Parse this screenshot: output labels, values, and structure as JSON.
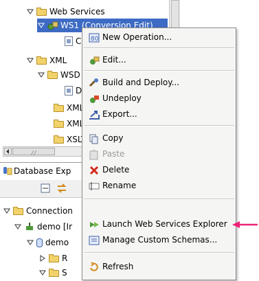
{
  "tree_top": {
    "items": [
      {
        "label": "Web Services"
      },
      {
        "label": "WS1 (Conversion Edit)"
      },
      {
        "label": "C"
      },
      {
        "label": "XML"
      },
      {
        "label": "WSD"
      },
      {
        "label": "D"
      },
      {
        "label": "XML"
      },
      {
        "label": "XML"
      },
      {
        "label": "XSLT"
      }
    ]
  },
  "db_panel": {
    "title": "Database Exp",
    "items": [
      {
        "label": "Connection"
      },
      {
        "label": "demo [Ir"
      },
      {
        "label": "demo"
      },
      {
        "label": "R"
      },
      {
        "label": "S"
      }
    ]
  },
  "context_menu": {
    "items": [
      {
        "label": "New Operation...",
        "icon": "new-operation-icon"
      },
      {
        "label": "Edit...",
        "icon": "edit-icon"
      },
      {
        "label": "Build and Deploy...",
        "icon": "build-deploy-icon"
      },
      {
        "label": "Undeploy",
        "icon": "undeploy-icon"
      },
      {
        "label": "Export...",
        "icon": "export-icon"
      },
      {
        "label": "Copy",
        "icon": "copy-icon"
      },
      {
        "label": "Paste",
        "icon": "paste-icon"
      },
      {
        "label": "Delete",
        "icon": "delete-icon"
      },
      {
        "label": "Rename",
        "icon": "rename-icon"
      },
      {
        "label": "Launch Web Services Explorer",
        "icon": "launch-explorer-icon"
      },
      {
        "label": "Manage Custom Schemas...",
        "icon": "manage-schemas-icon"
      },
      {
        "label": "Refresh",
        "icon": "refresh-icon"
      }
    ]
  },
  "colors": {
    "selection": "#3d6bc4",
    "menu_bg": "#f5f5f3",
    "annotation_arrow": "#ee2277"
  }
}
